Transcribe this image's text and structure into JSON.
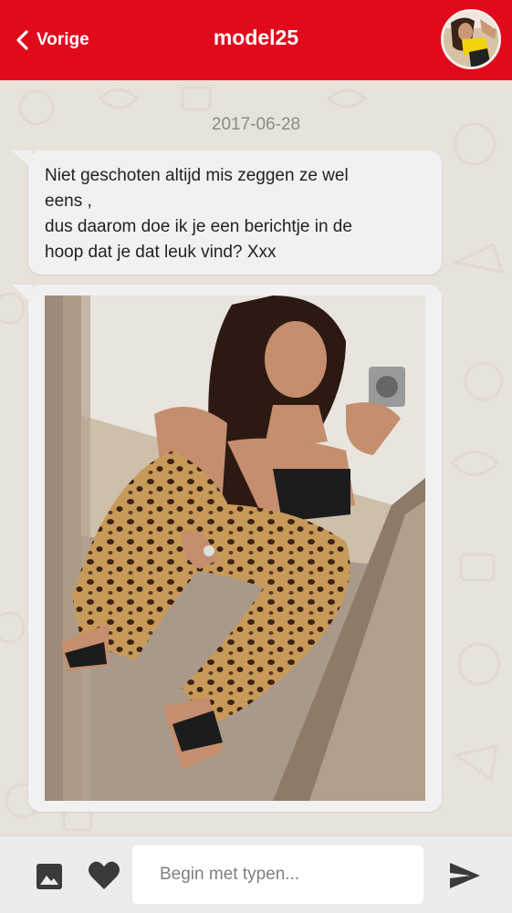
{
  "header": {
    "back_label": "Vorige",
    "title": "model25",
    "accent_color": "#e1091c",
    "avatar_icon": "profile-photo"
  },
  "chat": {
    "date": "2017-06-28",
    "messages": [
      {
        "type": "text",
        "lines": [
          "Niet geschoten altijd mis zeggen ze wel",
          "eens ,",
          "dus daarom doe ik je een berichtje in de",
          "hoop dat je dat leuk vind? Xxx"
        ]
      },
      {
        "type": "image",
        "icon": "mirror-selfie-photo"
      }
    ]
  },
  "composer": {
    "placeholder": "Begin met typen...",
    "value": "",
    "image_icon": "image-icon",
    "heart_icon": "heart-icon",
    "send_icon": "send-icon"
  }
}
